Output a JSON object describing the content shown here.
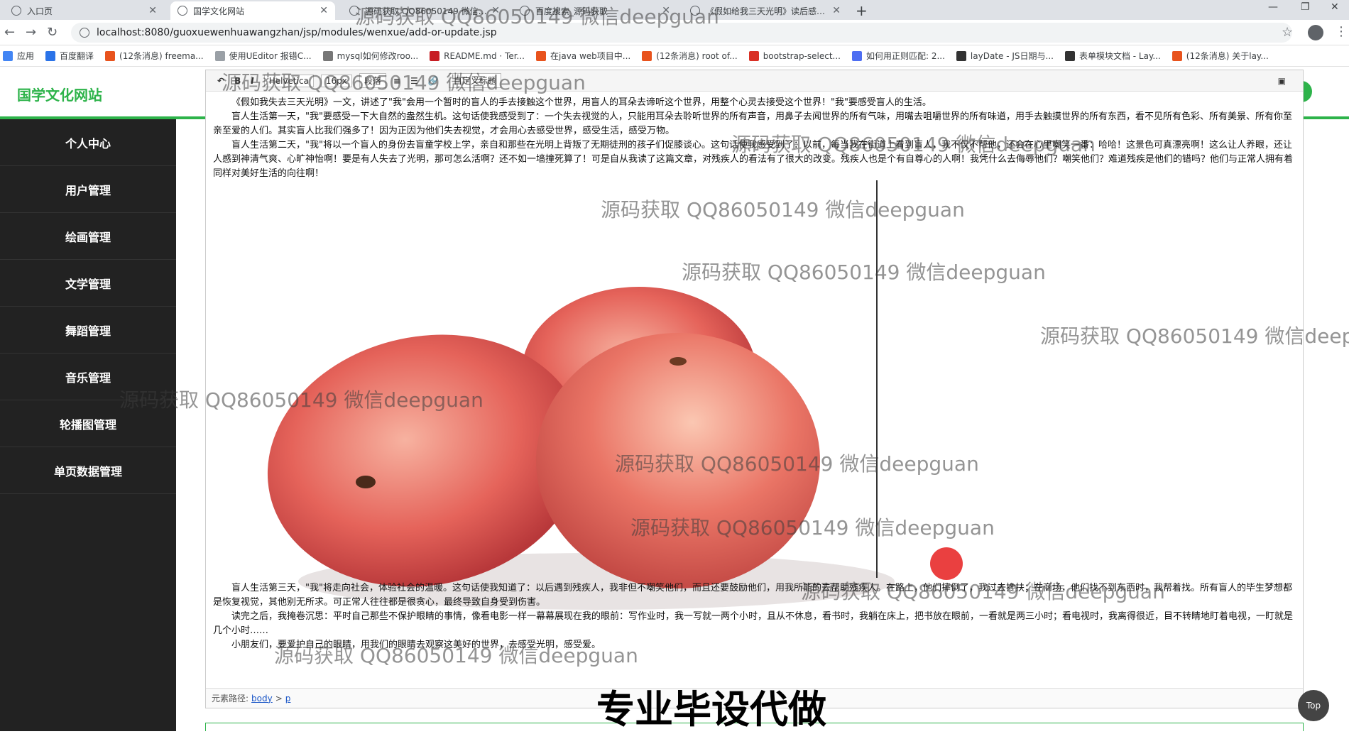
{
  "browser": {
    "tabs": [
      {
        "label": "入口页",
        "active": false
      },
      {
        "label": "国学文化网站",
        "active": true
      },
      {
        "label": "源码获取 QQ86050149 微信deepguan",
        "active": false
      },
      {
        "label": "百度搜索_源码获取",
        "active": false
      },
      {
        "label": "《假如给我三天光明》读后感作文",
        "active": false
      }
    ],
    "address": "localhost:8080/guoxuewenhuawangzhan/jsp/modules/wenxue/add-or-update.jsp",
    "bookmarks": [
      {
        "label": "应用",
        "icon": "apps-icon",
        "color": "#4285f4"
      },
      {
        "label": "百度翻译",
        "icon": "baidu-translate-icon",
        "color": "#2a73e8"
      },
      {
        "label": "(12条消息) freema...",
        "icon": "csdn-icon",
        "color": "#e8531d"
      },
      {
        "label": "使用UEditor 报错C...",
        "icon": "bug-icon",
        "color": "#9aa0a6"
      },
      {
        "label": "mysql如何修改roo...",
        "icon": "search-icon",
        "color": "#777"
      },
      {
        "label": "README.md · Ter...",
        "icon": "gitee-icon",
        "color": "#c71d23"
      },
      {
        "label": "在java web项目中...",
        "icon": "csdn-icon",
        "color": "#e8531d"
      },
      {
        "label": "(12条消息) root of...",
        "icon": "csdn-icon",
        "color": "#e8531d"
      },
      {
        "label": "bootstrap-select...",
        "icon": "bookmark-icon",
        "color": "#d93025"
      },
      {
        "label": "如何用正则匹配: 2...",
        "icon": "paw-icon",
        "color": "#4e6ef2"
      },
      {
        "label": "layDate - JS日期与...",
        "icon": "layui-icon",
        "color": "#333"
      },
      {
        "label": "表单模块文档 - Lay...",
        "icon": "layui-icon",
        "color": "#333"
      },
      {
        "label": "(12条消息) 关于lay...",
        "icon": "csdn-icon",
        "color": "#e8531d"
      }
    ]
  },
  "app": {
    "brand": "国学文化网站",
    "menu": [
      "个人中心",
      "用户管理",
      "绘画管理",
      "文学管理",
      "舞蹈管理",
      "音乐管理",
      "轮播图管理",
      "单页数据管理"
    ]
  },
  "editor": {
    "toolbar": {
      "font": "Helvetica",
      "size": "16px",
      "para": "段落",
      "custom": "自定义标题"
    },
    "paragraphs": [
      "《假如我失去三天光明》一文，讲述了\"我\"会用一个暂时的盲人的手去接触这个世界，用盲人的耳朵去谛听这个世界，用整个心灵去接受这个世界！\"我\"要感受盲人的生活。",
      "盲人生活第一天，\"我\"要感受一下大自然的盎然生机。这句话使我感受到了：一个失去视觉的人，只能用耳朵去聆听世界的所有声音，用鼻子去闻世界的所有气味，用嘴去咀嚼世界的所有味道，用手去触摸世界的所有东西，看不见所有色彩、所有美景、所有你至亲至爱的人们。其实盲人比我们强多了！因为正因为他们失去视觉，才会用心去感受世界，感受生活，感受万物。",
      "盲人生活第二天，\"我\"将以一个盲人的身份去盲童学校上学，亲自和那些在光明上背叛了无期徒刑的孩子们促膝谈心。这句话使我感受到了：以前，每当我在街道上看到盲人，我不仅不帮他，还会在心里嘲笑一番：哈哈！这景色可真漂亮啊！这么让人养眼，还让人感到神清气爽、心旷神怡啊！要是有人失去了光明，那可怎么活啊？还不如一墙撞死算了！可是自从我读了这篇文章，对残疾人的看法有了很大的改变。残疾人也是个有自尊心的人啊！我凭什么去侮辱他们？嘲笑他们？难道残疾是他们的错吗？他们与正常人拥有着同样对美好生活的向往啊！"
    ],
    "lower_paragraphs": [
      "盲人生活第三天，\"我\"将走向社会，体验社会的温暖。这句话使我知道了：以后遇到残疾人，我非但不嘲笑他们，而且还要鼓励他们，用我所能的去帮助残疾人。在路上，他们摔倒了，我过去搀扶；在商场，他们找不到东西时，我帮着找。所有盲人的毕生梦想都是恢复视觉，其他别无所求。可正常人往往都是很贪心，最终导致自身受到伤害。",
      "读完之后，我掩卷沉思：平时自己那些不保护眼睛的事情，像看电影一样一幕幕展现在我的眼前：写作业时，我一写就一两个小时，且从不休息，看书时，我躺在床上，把书放在眼前，一看就是两三小时；看电视时，我离得很近，目不转睛地盯着电视，一盯就是几个小时……",
      "小朋友们，要爱护自己的眼睛，用我们的眼睛去观察这美好的世界，去感受光明，感受爱。"
    ],
    "element_path_label": "元素路径:",
    "element_path": [
      "body",
      "p"
    ]
  },
  "top_button": "Top",
  "watermark": "源码获取 QQ86050149 微信deepguan",
  "banner": "专业毕设代做"
}
